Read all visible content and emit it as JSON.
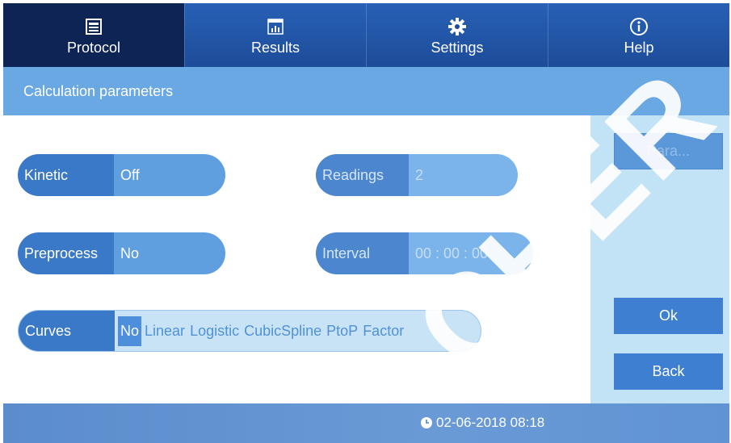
{
  "nav": {
    "tabs": [
      {
        "label": "Protocol",
        "icon": "protocol-icon"
      },
      {
        "label": "Results",
        "icon": "results-chart-icon"
      },
      {
        "label": "Settings",
        "icon": "gear-icon"
      },
      {
        "label": "Help",
        "icon": "info-icon"
      }
    ]
  },
  "title": "Calculation parameters",
  "fields": {
    "kinetic": {
      "label": "Kinetic",
      "value": "Off"
    },
    "readings": {
      "label": "Readings",
      "value": "2"
    },
    "preprocess": {
      "label": "Preprocess",
      "value": "No"
    },
    "interval": {
      "label": "Interval",
      "value": "00 : 00 : 00"
    }
  },
  "curves": {
    "label": "Curves",
    "options": [
      "No",
      "Linear",
      "Logistic",
      "CubicSpline",
      "PtoP",
      "Factor"
    ],
    "selected": "No"
  },
  "buttons": {
    "para": "Para...",
    "ok": "Ok",
    "back": "Back"
  },
  "footer": {
    "datetime": "02-06-2018 08:18"
  },
  "watermark": "CHER",
  "colors": {
    "nav_dark": "#0e2454",
    "nav": "#1d4c99",
    "title_bar": "#6aa8e3",
    "pill_key": "#3a78c8",
    "pill_value": "#5f9fe0",
    "right_panel": "#c2e3f6",
    "button": "#3e7fd1"
  }
}
